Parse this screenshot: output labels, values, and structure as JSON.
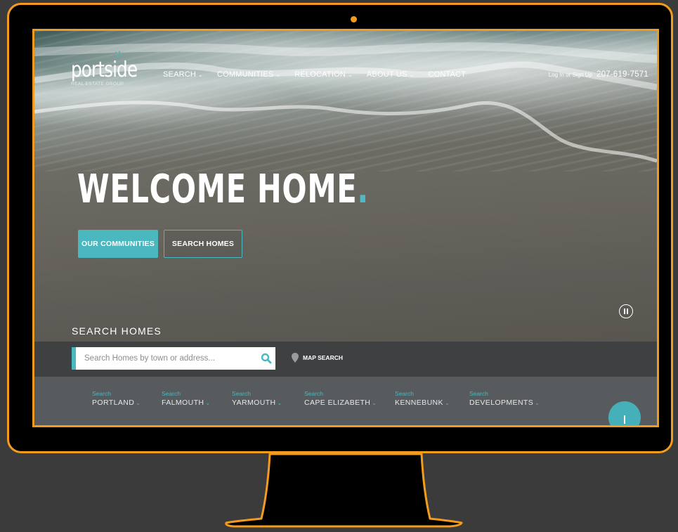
{
  "site": {
    "logo_word": "portside",
    "logo_sub": "REAL ESTATE GROUP"
  },
  "nav": {
    "items": [
      {
        "label": "SEARCH",
        "chevron": true
      },
      {
        "label": "COMMUNITIES",
        "chevron": true
      },
      {
        "label": "RELOCATION",
        "chevron": true
      },
      {
        "label": "ABOUT US",
        "chevron": true
      },
      {
        "label": "CONTACT",
        "chevron": false
      }
    ],
    "login": "Log In or Sign Up",
    "phone": "207-619-7571"
  },
  "hero": {
    "headline": "WELCOME HOME",
    "headline_dot": ".",
    "primary_button": "OUR COMMUNITIES",
    "secondary_button": "SEARCH HOMES"
  },
  "search": {
    "title": "SEARCH HOMES",
    "placeholder": "Search Homes by town or address...",
    "map_search": "MAP SEARCH"
  },
  "quick_search": [
    {
      "top": "Search",
      "town": "PORTLAND"
    },
    {
      "top": "Search",
      "town": "FALMOUTH"
    },
    {
      "top": "Search",
      "town": "YARMOUTH"
    },
    {
      "top": "Search",
      "town": "CAPE ELIZABETH"
    },
    {
      "top": "Search",
      "town": "KENNEBUNK"
    },
    {
      "top": "Search",
      "town": "DEVELOPMENTS"
    }
  ],
  "colors": {
    "frame": "#f39b1f",
    "accent": "#4bb7bf",
    "background": "#3b3b3c"
  }
}
